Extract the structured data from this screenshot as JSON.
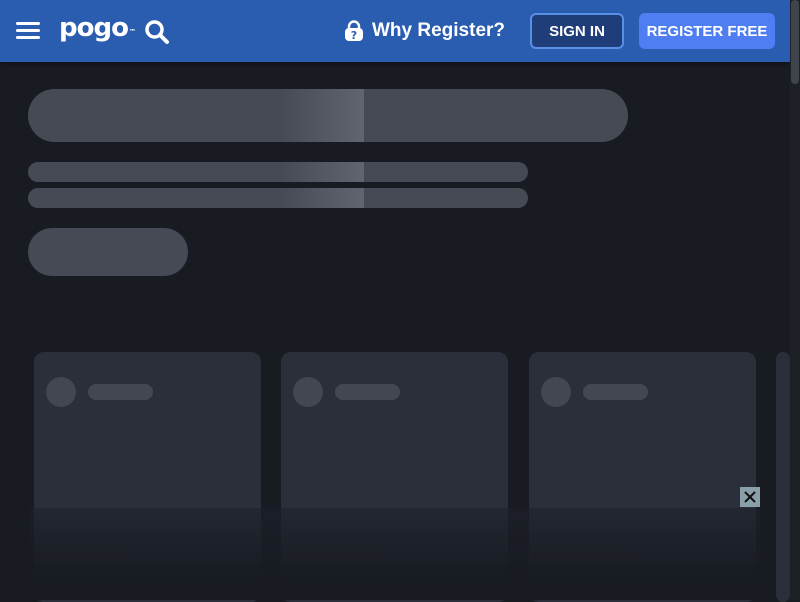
{
  "header": {
    "logo": "pogo",
    "logo_tm": "™",
    "why_register": "Why Register?",
    "sign_in": "SIGN IN",
    "register_free": "REGISTER FREE"
  },
  "icons": {
    "menu": "hamburger-menu",
    "search": "magnifier",
    "why_register": "lock-question",
    "close": "x"
  },
  "colors": {
    "header_bg": "#2a5cb0",
    "page_bg": "#181b22",
    "register_button": "#4f7ef2",
    "sign_in_button": "#1f3d78",
    "skeleton": "#454a55",
    "card": "#2a2f39"
  }
}
